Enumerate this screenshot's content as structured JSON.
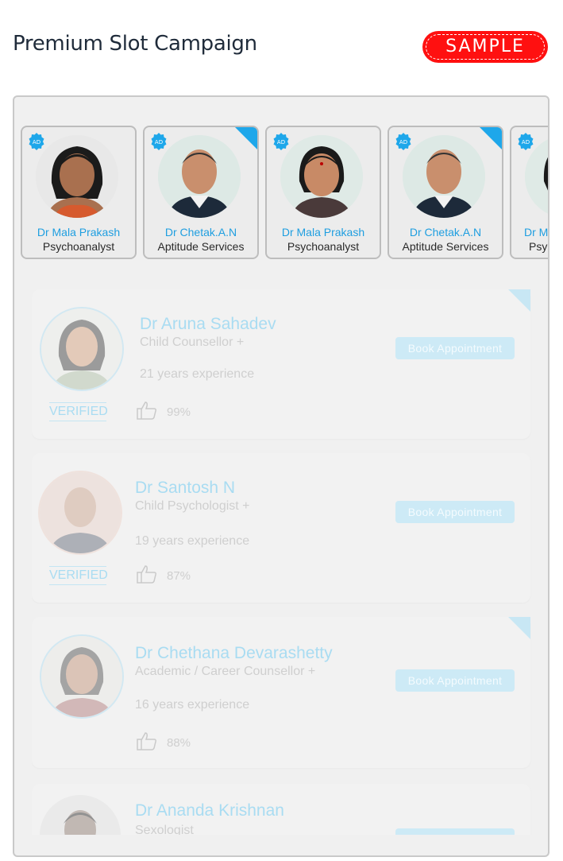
{
  "header": {
    "title": "Premium Slot Campaign",
    "badge": "SAMPLE"
  },
  "colors": {
    "accent_blue": "#1ea7ea",
    "badge_red": "#ff1010",
    "faded_blue": "#a9dcf2"
  },
  "premium_slots": [
    {
      "name": "Dr Mala Prakash",
      "specialty": "Psychoanalyst",
      "ad_badge": "AD",
      "featured_corner": false
    },
    {
      "name": "Dr Chetak.A.N",
      "specialty": "Aptitude Services",
      "ad_badge": "AD",
      "featured_corner": true
    },
    {
      "name": "Dr Mala Prakash",
      "specialty": "Psychoanalyst",
      "ad_badge": "AD",
      "featured_corner": false
    },
    {
      "name": "Dr Chetak.A.N",
      "specialty": "Aptitude Services",
      "ad_badge": "AD",
      "featured_corner": true
    },
    {
      "name": "Dr Mala Prakash",
      "specialty": "Psychoanalyst",
      "ad_badge": "AD",
      "featured_corner": false
    }
  ],
  "listings": [
    {
      "name": "Dr Aruna Sahadev",
      "specialty": "Child Counsellor +",
      "experience": "21 years experience",
      "rating": "99%",
      "verified": "VERIFIED",
      "button": "Book  Appointment"
    },
    {
      "name": "Dr Santosh N",
      "specialty": "Child Psychologist +",
      "experience": "19 years experience",
      "rating": "87%",
      "verified": "VERIFIED",
      "button": "Book  Appointment"
    },
    {
      "name": "Dr Chethana Devarashetty",
      "specialty": "Academic / Career Counsellor +",
      "experience": "16 years experience",
      "rating": "88%",
      "verified": "",
      "button": "Book  Appointment"
    },
    {
      "name": "Dr Ananda Krishnan",
      "specialty": "Sexologist",
      "experience": "",
      "rating": "",
      "verified": "",
      "button": ""
    }
  ]
}
